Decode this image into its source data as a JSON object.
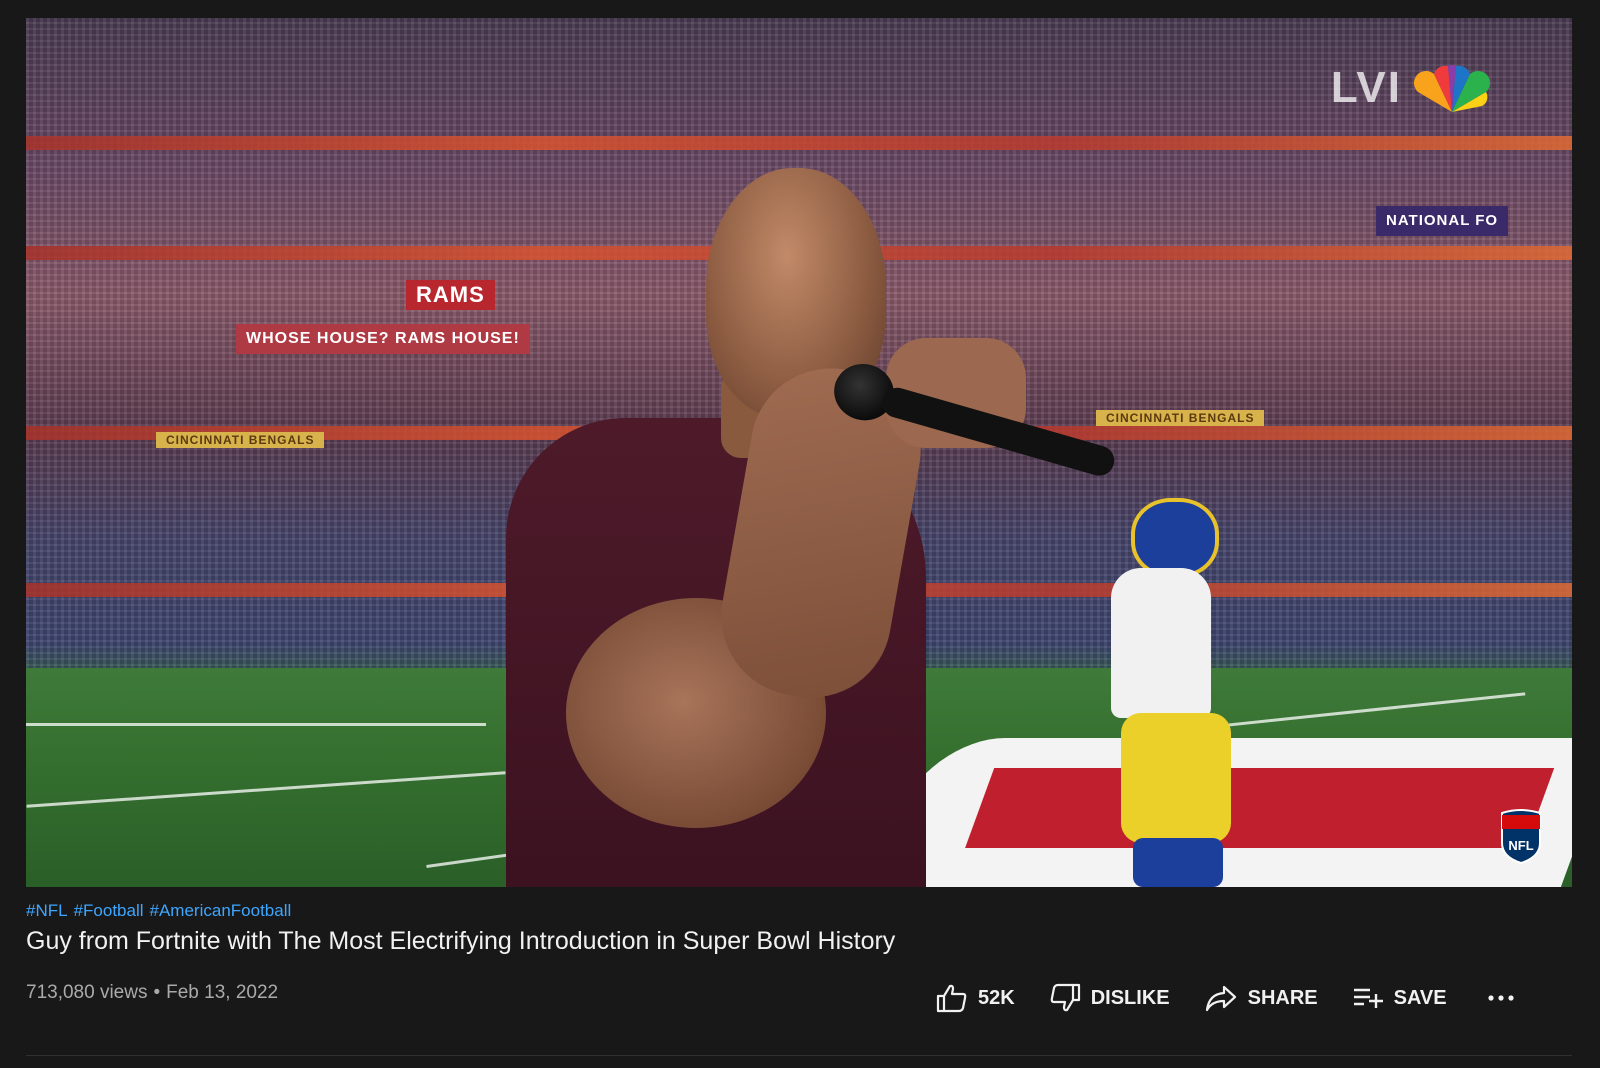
{
  "video": {
    "hashtags": [
      "#NFL",
      "#Football",
      "#AmericanFootball"
    ],
    "title": "Guy from Fortnite with The Most Electrifying Introduction in Super Bowl History",
    "views": "713,080 views",
    "separator": "•",
    "date": "Feb 13, 2022"
  },
  "overlay": {
    "network_text": "LVI",
    "banner_rams": "RAMS",
    "banner_house": "WHOSE HOUSE? RAMS HOUSE!",
    "banner_bengals_left": "CINCINNATI BENGALS",
    "banner_bengals_right": "CINCINNATI BENGALS",
    "banner_nfl": "NATIONAL FO"
  },
  "actions": {
    "like_count": "52K",
    "dislike_label": "DISLIKE",
    "share_label": "SHARE",
    "save_label": "SAVE",
    "more_label": "..."
  },
  "icons": {
    "like": "thumbs-up-icon",
    "dislike": "thumbs-down-icon",
    "share": "share-arrow-icon",
    "save": "playlist-add-icon",
    "more": "more-horizontal-icon"
  },
  "colors": {
    "background": "#181818",
    "hashtag_link": "#3ea6ff",
    "primary_text": "#f1f1f1",
    "secondary_text": "#aaaaaa"
  }
}
